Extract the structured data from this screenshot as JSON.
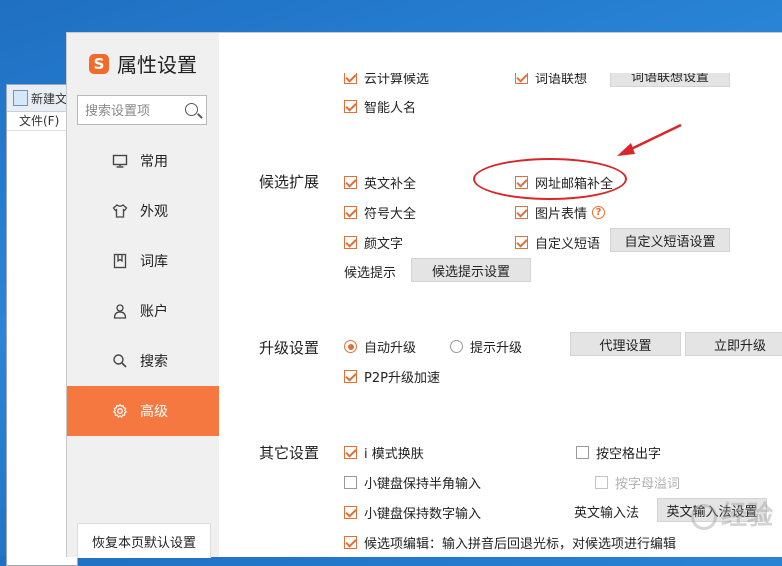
{
  "background_window": {
    "title": "新建文",
    "menu": "文件(F)"
  },
  "dialog": {
    "app_title": "属性设置",
    "logo_letter": "S",
    "help_label": "?",
    "minimize_label": "—",
    "search_placeholder": "搜索设置项",
    "nav": [
      {
        "label": "常用",
        "icon": "monitor-icon"
      },
      {
        "label": "外观",
        "icon": "shirt-icon"
      },
      {
        "label": "词库",
        "icon": "book-icon"
      },
      {
        "label": "账户",
        "icon": "user-icon"
      },
      {
        "label": "搜索",
        "icon": "search-icon"
      },
      {
        "label": "高级",
        "icon": "gear-icon"
      }
    ],
    "active_nav": "高级",
    "restore_label": "恢复本页默认设置"
  },
  "content": {
    "top_partial": {
      "cloud": "云计算候选",
      "assoc": "词语联想",
      "assoc_btn": "词语联想设置"
    },
    "smart_name": "智能人名",
    "candidate_ext": {
      "title": "候选扩展",
      "english": "英文补全",
      "email": "网址邮箱补全",
      "symbols": "符号大全",
      "emoji_img": "图片表情",
      "kaomoji": "颜文字",
      "custom_phrase": "自定义短语",
      "custom_phrase_btn": "自定义短语设置",
      "hint_label": "候选提示",
      "hint_btn": "候选提示设置"
    },
    "upgrade": {
      "title": "升级设置",
      "auto": "自动升级",
      "prompt": "提示升级",
      "proxy_btn": "代理设置",
      "now_btn": "立即升级",
      "p2p": "P2P升级加速"
    },
    "other": {
      "title": "其它设置",
      "imode": "i 模式换肤",
      "space_out": "按空格出字",
      "half_width": "小键盘保持半角输入",
      "letter_mark": "按字母溢词",
      "numeric": "小键盘保持数字输入",
      "en_input_label": "英文输入法",
      "en_input_btn": "英文输入法设置",
      "edit_candidate": "候选项编辑：输入拼音后回退光标，对候选项进行编辑"
    }
  },
  "colors": {
    "accent": "#f57841",
    "annotation": "#d8262a"
  },
  "watermark": "经验"
}
